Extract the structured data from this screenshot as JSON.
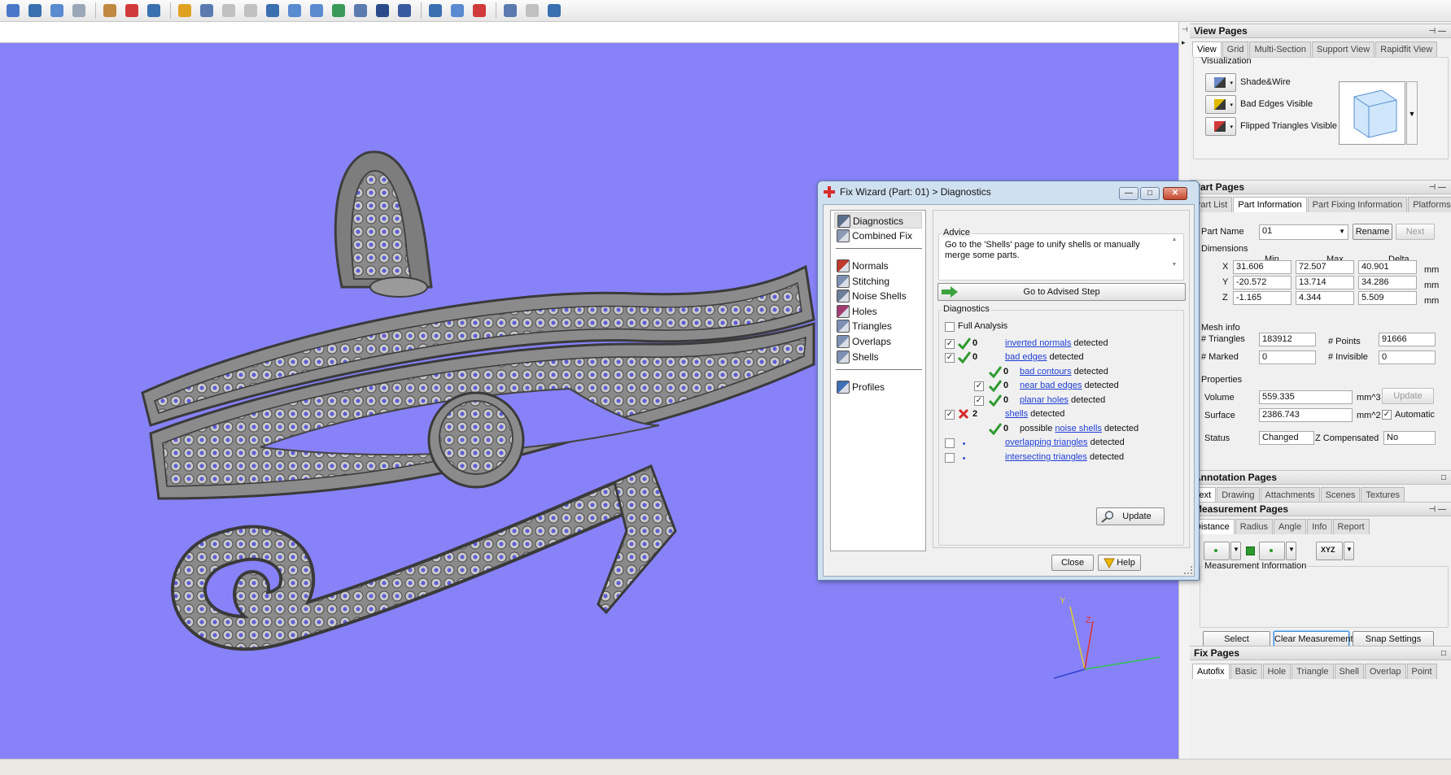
{
  "toolbar": {
    "icons": [
      "part-stack-icon",
      "scissors-icon",
      "copy-parts-icon",
      "paste-icon",
      "hand-pan-icon",
      "add-part-icon",
      "cube-icon",
      "wand-icon",
      "text-tool-icon",
      "disabled-tool-icon",
      "disabled-tool-icon",
      "solid-view-icon",
      "stack-view-icon",
      "cut-view-icon",
      "arrow-up-icon",
      "plane-icon",
      "frame-icon",
      "sphere-icon",
      "lightning-icon",
      "globe-icon",
      "link-icon",
      "measure-icon",
      "disabled-tool-icon",
      "export-icon"
    ]
  },
  "colors": {
    "viewport": "#8882f8",
    "link": "#1f3fd6",
    "dialog_frame": "#cfe0f0",
    "check_green": "#2f9a2f",
    "cross_red": "#d62b2b"
  },
  "view_pages": {
    "title": "View Pages",
    "tabs": [
      "View",
      "Grid",
      "Multi-Section",
      "Support View",
      "Rapidfit View"
    ],
    "visualization_label": "Visualization",
    "options": [
      {
        "label": "Shade&Wire",
        "icon": "shade-wire-icon"
      },
      {
        "label": "Bad Edges Visible",
        "icon": "bad-edges-icon"
      },
      {
        "label": "Flipped Triangles Visible",
        "icon": "flipped-triangles-icon"
      }
    ]
  },
  "part_pages": {
    "title": "Part Pages",
    "tabs": [
      "Part List",
      "Part Information",
      "Part Fixing Information",
      "Platforms"
    ],
    "part_name_label": "Part Name",
    "part_name_value": "01",
    "rename_label": "Rename",
    "next_label": "Next",
    "dimensions_label": "Dimensions",
    "col_min": "Min",
    "col_max": "Max",
    "col_delta": "Delta",
    "rows": [
      {
        "axis": "X",
        "min": "31.606",
        "max": "72.507",
        "delta": "40.901",
        "unit": "mm"
      },
      {
        "axis": "Y",
        "min": "-20.572",
        "max": "13.714",
        "delta": "34.286",
        "unit": "mm"
      },
      {
        "axis": "Z",
        "min": "-1.165",
        "max": "4.344",
        "delta": "5.509",
        "unit": "mm"
      }
    ],
    "mesh_info_label": "Mesh info",
    "triangles_label": "# Triangles",
    "triangles_value": "183912",
    "points_label": "# Points",
    "points_value": "91666",
    "marked_label": "# Marked",
    "marked_value": "0",
    "invisible_label": "# Invisible",
    "invisible_value": "0",
    "properties_label": "Properties",
    "volume_label": "Volume",
    "volume_value": "559.335",
    "volume_unit": "mm^3",
    "update_label": "Update",
    "surface_label": "Surface",
    "surface_value": "2386.743",
    "surface_unit": "mm^2",
    "automatic_label": "Automatic",
    "status_label": "Status",
    "status_value": "Changed",
    "zcomp_label": "Z Compensated",
    "zcomp_value": "No"
  },
  "annotation_pages": {
    "title": "Annotation Pages",
    "tabs": [
      "Text",
      "Drawing",
      "Attachments",
      "Scenes",
      "Textures"
    ]
  },
  "measurement_pages": {
    "title": "Measurement Pages",
    "tabs": [
      "Distance",
      "Radius",
      "Angle",
      "Info",
      "Report"
    ],
    "info_label": "Measurement Information",
    "select_label": "Select",
    "clear_label": "Clear Measurements",
    "snap_label": "Snap Settings",
    "xyz_label": "XYZ"
  },
  "fix_pages": {
    "title": "Fix Pages",
    "tabs": [
      "Autofix",
      "Basic",
      "Hole",
      "Triangle",
      "Shell",
      "Overlap",
      "Point"
    ]
  },
  "dialog": {
    "title": "Fix Wizard (Part: 01) > Diagnostics",
    "nav": [
      {
        "label": "Diagnostics",
        "icon": "magnifier-icon",
        "color": "#5a6f8a"
      },
      {
        "label": "Combined Fix",
        "icon": "combined-fix-icon",
        "color": "#8a9ab5"
      },
      {
        "label": "Normals",
        "icon": "normals-icon",
        "color": "#c0392b"
      },
      {
        "label": "Stitching",
        "icon": "stitching-icon",
        "color": "#7d8fb3"
      },
      {
        "label": "Noise Shells",
        "icon": "noise-shells-icon",
        "color": "#6f7f99"
      },
      {
        "label": "Holes",
        "icon": "holes-icon",
        "color": "#a23b72"
      },
      {
        "label": "Triangles",
        "icon": "triangles-icon",
        "color": "#7d8fb3"
      },
      {
        "label": "Overlaps",
        "icon": "overlaps-icon",
        "color": "#7d8fb3"
      },
      {
        "label": "Shells",
        "icon": "shells-icon",
        "color": "#7d8fb3"
      },
      {
        "label": "Profiles",
        "icon": "profiles-icon",
        "color": "#3f6fb5"
      }
    ],
    "advice_label": "Advice",
    "advice_text": "Go to the 'Shells' page to unify shells or manually merge some parts.",
    "advised_step_label": "Go to Advised Step",
    "diagnostics_label": "Diagnostics",
    "full_analysis_label": "Full Analysis",
    "rows": [
      {
        "checked": true,
        "status": "ok",
        "count": "0",
        "pre": "",
        "link": "inverted normals",
        "post": " detected"
      },
      {
        "checked": true,
        "status": "ok",
        "count": "0",
        "pre": "",
        "link": "bad edges",
        "post": " detected"
      },
      {
        "checked": null,
        "status": "ok",
        "count": "0",
        "pre": "",
        "link": "bad contours",
        "post": " detected"
      },
      {
        "checked": true,
        "status": "ok",
        "count": "0",
        "pre": "",
        "link": "near bad edges",
        "post": " detected"
      },
      {
        "checked": true,
        "status": "ok",
        "count": "0",
        "pre": "",
        "link": "planar holes",
        "post": " detected"
      },
      {
        "checked": true,
        "status": "error",
        "count": "2",
        "pre": "",
        "link": "shells",
        "post": " detected"
      },
      {
        "checked": null,
        "status": "ok",
        "count": "0",
        "pre": "possible ",
        "link": "noise shells",
        "post": " detected"
      },
      {
        "checked": false,
        "status": "none",
        "count": "",
        "pre": "",
        "link": "overlapping triangles",
        "post": " detected"
      },
      {
        "checked": false,
        "status": "none",
        "count": "",
        "pre": "",
        "link": "intersecting triangles",
        "post": " detected"
      }
    ],
    "update_label": "Update",
    "close_label": "Close",
    "help_label": "Help"
  },
  "axes": {
    "y": "Y",
    "z": "Z"
  }
}
